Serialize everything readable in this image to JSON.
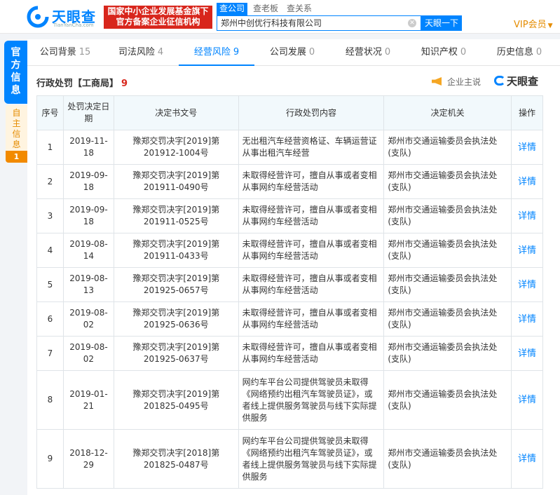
{
  "header": {
    "brand_name": "天眼查",
    "brand_domain": "TianYanCha.com",
    "banner_line1": "国家中小企业发展基金旗下",
    "banner_line2": "官方备案企业征信机构",
    "product_tabs": [
      "查公司",
      "查老板",
      "查关系"
    ],
    "search_value": "郑州中创优行科技有限公司",
    "search_button": "天眼一下",
    "vip_label": "VIP会员",
    "accent_color": "#0084ff",
    "banner_color": "#d8261c"
  },
  "side_tabs": {
    "official": "官方信息",
    "self": "自主信息",
    "self_count": "1"
  },
  "tabs": [
    {
      "label": "公司背景",
      "count": "15"
    },
    {
      "label": "司法风险",
      "count": "4"
    },
    {
      "label": "经营风险",
      "count": "9"
    },
    {
      "label": "公司发展",
      "count": "0"
    },
    {
      "label": "经营状况",
      "count": "0"
    },
    {
      "label": "知识产权",
      "count": "0"
    },
    {
      "label": "历史信息",
      "count": "0"
    }
  ],
  "section": {
    "title": "行政处罚【工商局】",
    "count": "9",
    "speak_label": "企业主说",
    "brand_mini": "天眼查"
  },
  "table": {
    "headers": [
      "序号",
      "处罚决定日期",
      "决定书文号",
      "行政处罚内容",
      "决定机关",
      "操作"
    ],
    "rows": [
      {
        "no": "1",
        "date": "2019-11-18",
        "doc": "豫郑交罚决字[2019]第201912-1004号",
        "content": "无出租汽车经营资格证、车辆运营证从事出租汽车经营",
        "authority": "郑州市交通运输委员会执法处(支队)",
        "action": "详情"
      },
      {
        "no": "2",
        "date": "2019-09-18",
        "doc": "豫郑交罚决字[2019]第201911-0490号",
        "content": "未取得经营许可，擅自从事或者变相从事网约车经营活动",
        "authority": "郑州市交通运输委员会执法处(支队)",
        "action": "详情"
      },
      {
        "no": "3",
        "date": "2019-09-18",
        "doc": "豫郑交罚决字[2019]第201911-0525号",
        "content": "未取得经营许可，擅自从事或者变相从事网约车经营活动",
        "authority": "郑州市交通运输委员会执法处(支队)",
        "action": "详情"
      },
      {
        "no": "4",
        "date": "2019-08-14",
        "doc": "豫郑交罚决字[2019]第201911-0433号",
        "content": "未取得经营许可，擅自从事或者变相从事网约车经营活动",
        "authority": "郑州市交通运输委员会执法处(支队)",
        "action": "详情"
      },
      {
        "no": "5",
        "date": "2019-08-13",
        "doc": "豫郑交罚决字[2019]第201925-0657号",
        "content": "未取得经营许可，擅自从事或者变相从事网约车经营活动",
        "authority": "郑州市交通运输委员会执法处(支队)",
        "action": "详情"
      },
      {
        "no": "6",
        "date": "2019-08-02",
        "doc": "豫郑交罚决字[2019]第201925-0636号",
        "content": "未取得经营许可，擅自从事或者变相从事网约车经营活动",
        "authority": "郑州市交通运输委员会执法处(支队)",
        "action": "详情"
      },
      {
        "no": "7",
        "date": "2019-08-02",
        "doc": "豫郑交罚决字[2019]第201925-0637号",
        "content": "未取得经营许可，擅自从事或者变相从事网约车经营活动",
        "authority": "郑州市交通运输委员会执法处(支队)",
        "action": "详情"
      },
      {
        "no": "8",
        "date": "2019-01-21",
        "doc": "豫郑交罚决字[2019]第201825-0495号",
        "content": "网约车平台公司提供驾驶员未取得《网络预约出租汽车驾驶员证》，或者线上提供服务驾驶员与线下实际提供服务",
        "authority": "郑州市交通运输委员会执法处(支队)",
        "action": "详情"
      },
      {
        "no": "9",
        "date": "2018-12-29",
        "doc": "豫郑交罚决字[2018]第201825-0487号",
        "content": "网约车平台公司提供驾驶员未取得《网络预约出租汽车驾驶员证》，或者线上提供服务驾驶员与线下实际提供服务",
        "authority": "郑州市交通运输委员会执法处(支队)",
        "action": "详情"
      }
    ]
  }
}
